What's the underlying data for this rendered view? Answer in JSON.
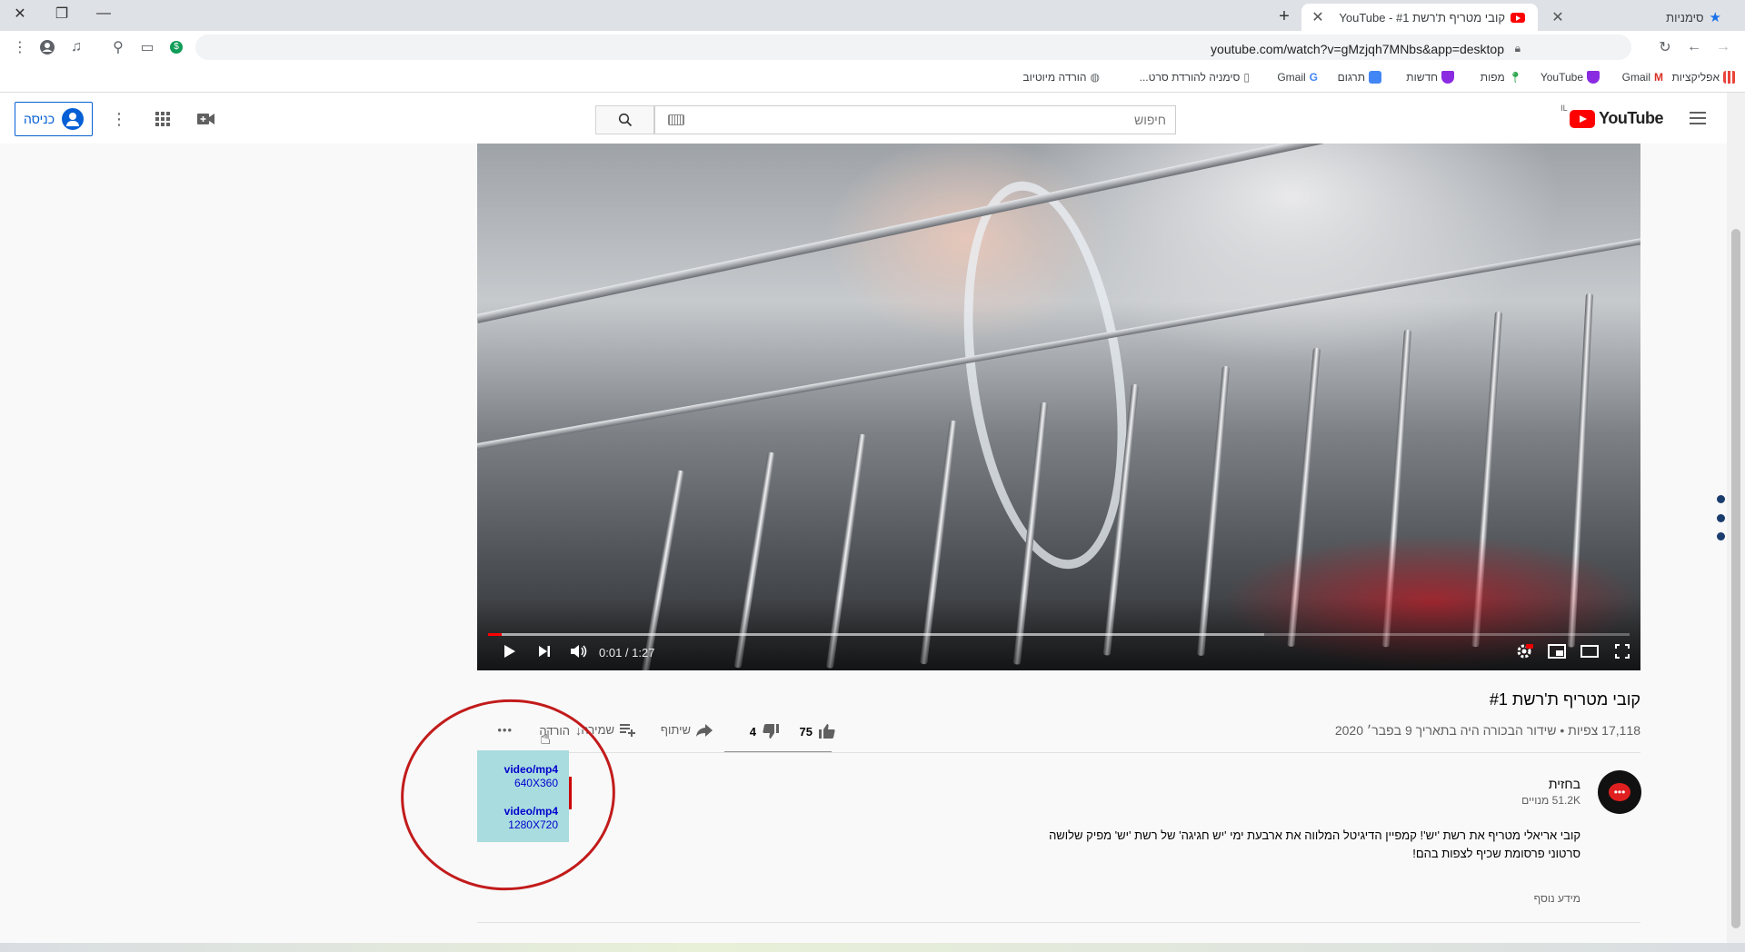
{
  "browser": {
    "active_tab_title": "קובי מטריף ת'רשת #1 - YouTube",
    "bookmarks_tab_title": "סימניות",
    "url": "youtube.com/watch?v=gMzjqh7MNbs&app=desktop",
    "bookmarks": [
      {
        "label": "אפליקציות",
        "color": "#e8453c"
      },
      {
        "label": "Gmail",
        "color": "#d93025"
      },
      {
        "label": "YouTube",
        "color": "#8a2be2"
      },
      {
        "label": "מפות",
        "color": "#34a853"
      },
      {
        "label": "חדשות",
        "color": "#8a2be2"
      },
      {
        "label": "תרגום",
        "color": "#4285f4"
      },
      {
        "label": "Gmail",
        "color": "#4285f4"
      },
      {
        "label": "סימניה להורדת סרט...",
        "color": "#5f6368"
      },
      {
        "label": "הורדה מיוטיוב",
        "color": "#5f6368"
      }
    ]
  },
  "masthead": {
    "logo_text": "YouTube",
    "country_code": "IL",
    "search_placeholder": "חיפוש",
    "signin_label": "כניסה"
  },
  "player": {
    "time_current": "0:01",
    "time_separator": " / ",
    "time_total": "1:27",
    "played_fraction": 0.012,
    "buffered_fraction": 0.68
  },
  "video": {
    "title": "קובי מטריף ת'רשת #1",
    "views": "17,118 צפיות",
    "premiere": "שידור הבכורה היה בתאריך 9 בפבר׳ 2020",
    "meta_separator": " • ",
    "likes": "75",
    "dislikes": "4",
    "share_label": "שיתוף",
    "save_label": "שמירה",
    "download_label": "הורדה",
    "more_label": "•••"
  },
  "download_menu": [
    {
      "format": "video/mp4",
      "resolution": "640X360"
    },
    {
      "format": "video/mp4",
      "resolution": "1280X720"
    }
  ],
  "channel": {
    "name": "בחזית",
    "subscribers": "51.2K מנויים",
    "description_line1": "קובי אריאלי מטריף את רשת 'יש'! קמפיין הדיגיטל המלווה את ארבעת ימי 'יש חגיגה' של רשת 'יש' מפיק שלושה",
    "description_line2": "סרטוני פרסומת שכיף לצפות בהם!",
    "show_more": "מידע נוסף"
  },
  "colors": {
    "accent_blue": "#065fd4",
    "yt_red": "#ff0000",
    "annotation_red": "#c21b1b",
    "menu_bg": "#a9dcdf"
  }
}
